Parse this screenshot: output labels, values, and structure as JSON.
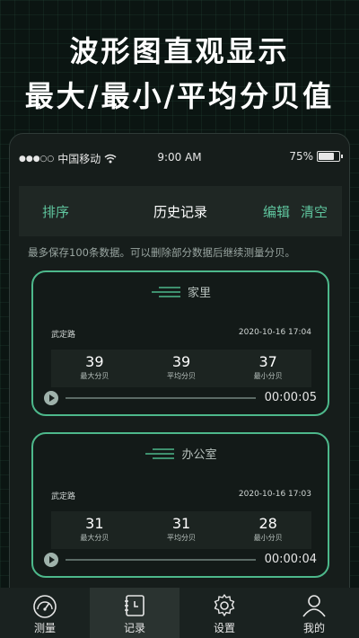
{
  "promo": {
    "line1": "波形图直观显示",
    "line2": "最大/最小/平均分贝值"
  },
  "status_bar": {
    "signal": "●●●○○",
    "carrier": "中国移动",
    "time": "9:00 AM",
    "battery_text": "75%",
    "battery_level": 0.75
  },
  "nav": {
    "sort": "排序",
    "title": "历史记录",
    "edit": "编辑",
    "clear": "清空"
  },
  "notice": "最多保存100条数据。可以删除部分数据后继续测量分贝。",
  "records": [
    {
      "name": "家里",
      "location": "武定路",
      "datetime": "2020-10-16 17:04",
      "max_value": "39",
      "max_label": "最大分贝",
      "avg_value": "39",
      "avg_label": "平均分贝",
      "min_value": "37",
      "min_label": "最小分贝",
      "duration": "00:00:05"
    },
    {
      "name": "办公室",
      "location": "武定路",
      "datetime": "2020-10-16 17:03",
      "max_value": "31",
      "max_label": "最大分贝",
      "avg_value": "31",
      "avg_label": "平均分贝",
      "min_value": "28",
      "min_label": "最小分贝",
      "duration": "00:00:04"
    }
  ],
  "tabs": [
    {
      "label": "测量",
      "icon": "gauge-icon"
    },
    {
      "label": "记录",
      "icon": "notebook-icon"
    },
    {
      "label": "设置",
      "icon": "gear-icon"
    },
    {
      "label": "我的",
      "icon": "user-icon"
    }
  ],
  "colors": {
    "accent": "#4db88b",
    "background": "#0b1512"
  }
}
